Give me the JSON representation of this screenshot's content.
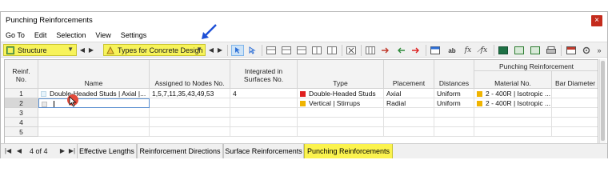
{
  "window": {
    "title": "Punching Reinforcements",
    "close_glyph": "×"
  },
  "menu": [
    "Go To",
    "Edit",
    "Selection",
    "View",
    "Settings"
  ],
  "toolbar": {
    "structure_label": "Structure",
    "types_label": "Types for Concrete Design",
    "icons": [
      "select-arrow-icon",
      "cursor-icon",
      "table-icon",
      "table-icon",
      "table-icon",
      "table-icon",
      "table-icon",
      "delete-icon",
      "columns-icon",
      "arrow-icon",
      "arrow-icon",
      "arrow-icon",
      "table-view-icon",
      "text-format-icon",
      "fx-icon",
      "fx-icon",
      "excel-icon",
      "export-icon",
      "import-icon",
      "print-icon",
      "settings-icon",
      "more-icon"
    ]
  },
  "columns": {
    "reinf_no": "Reinf.\nNo.",
    "name": "Name",
    "assigned": "Assigned to Nodes No.",
    "integrated": "Integrated in\nSurfaces No.",
    "type": "Type",
    "placement": "Placement",
    "distances": "Distances",
    "punching_group": "Punching Reinforcement",
    "material": "Material No.",
    "bar_diameter": "Bar Diameter"
  },
  "rows": [
    {
      "no": "1",
      "name_color": "#e6f3fb",
      "name": "Double-Headed Studs | Axial |...",
      "assigned": "1,5,7,11,35,43,49,53",
      "integrated": "4",
      "type_color": "#e02020",
      "type": "Double-Headed Studs",
      "placement": "Axial",
      "distances": "Uniform",
      "material_color": "#f0b400",
      "material": "2 - 400R | Isotropic ...",
      "bar_diameter": ""
    },
    {
      "no": "2",
      "name_color": "#e8e8e8",
      "name": "",
      "assigned": "",
      "integrated": "",
      "type_color": "#f0b400",
      "type": "Vertical | Stirrups",
      "placement": "Radial",
      "distances": "Uniform",
      "material_color": "#f0b400",
      "material": "2 - 400R | Isotropic ...",
      "bar_diameter": ""
    },
    {
      "no": "3",
      "name": "",
      "assigned": "",
      "integrated": "",
      "type": "",
      "placement": "",
      "distances": "",
      "material": "",
      "bar_diameter": ""
    },
    {
      "no": "4",
      "name": "",
      "assigned": "",
      "integrated": "",
      "type": "",
      "placement": "",
      "distances": "",
      "material": "",
      "bar_diameter": ""
    },
    {
      "no": "5",
      "name": "",
      "assigned": "",
      "integrated": "",
      "type": "",
      "placement": "",
      "distances": "",
      "material": "",
      "bar_diameter": ""
    }
  ],
  "footer": {
    "pager": "4 of 4",
    "tabs": [
      "Effective Lengths",
      "Reinforcement Directions",
      "Surface Reinforcements",
      "Punching Reinforcements"
    ],
    "active_tab": "Punching Reinforcements"
  },
  "colors": {
    "highlight": "#fbf34e",
    "annotation": "#1c4fd6",
    "cursor_marker": "#e34a3b"
  }
}
